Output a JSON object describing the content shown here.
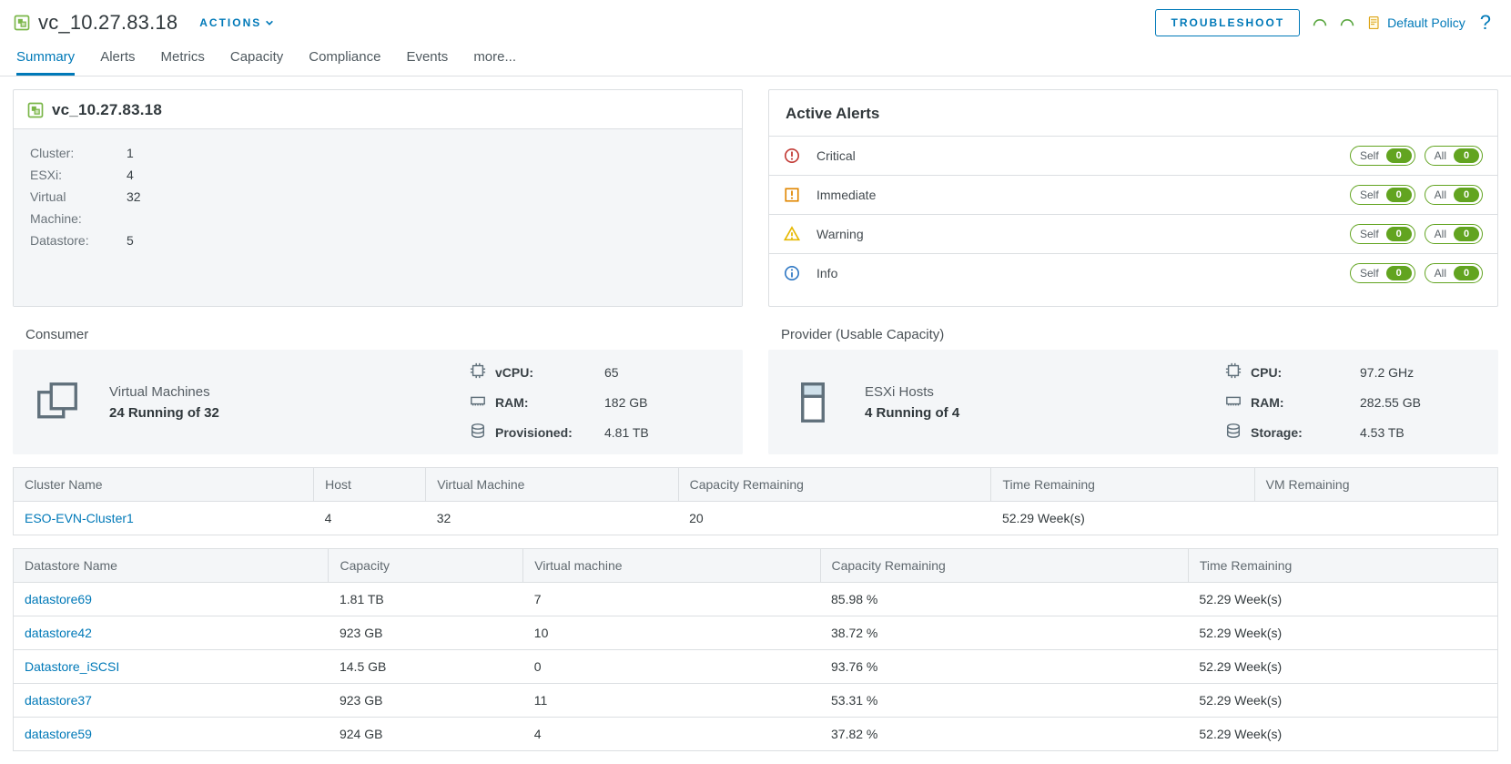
{
  "header": {
    "title": "vc_10.27.83.18",
    "actions_label": "ACTIONS",
    "troubleshoot_label": "TROUBLESHOOT",
    "policy_label": "Default Policy"
  },
  "tabs": [
    "Summary",
    "Alerts",
    "Metrics",
    "Capacity",
    "Compliance",
    "Events",
    "more..."
  ],
  "active_tab": 0,
  "summary_card": {
    "title": "vc_10.27.83.18",
    "rows": [
      {
        "k": "Cluster:",
        "v": "1"
      },
      {
        "k": "ESXi:",
        "v": "4"
      },
      {
        "k": "Virtual Machine:",
        "v": "32"
      },
      {
        "k": "Datastore:",
        "v": "5"
      }
    ]
  },
  "active_alerts": {
    "title": "Active Alerts",
    "rows": [
      {
        "label": "Critical",
        "icon": "critical",
        "self": 0,
        "all": 0
      },
      {
        "label": "Immediate",
        "icon": "immediate",
        "self": 0,
        "all": 0
      },
      {
        "label": "Warning",
        "icon": "warning",
        "self": 0,
        "all": 0
      },
      {
        "label": "Info",
        "icon": "info",
        "self": 0,
        "all": 0
      }
    ],
    "chip_self": "Self",
    "chip_all": "All"
  },
  "consumer": {
    "section_title": "Consumer",
    "head_t1": "Virtual Machines",
    "head_t2": "24 Running of 32",
    "metrics": [
      {
        "icon": "cpu",
        "label": "vCPU:",
        "value": "65"
      },
      {
        "icon": "ram",
        "label": "RAM:",
        "value": "182 GB"
      },
      {
        "icon": "disk",
        "label": "Provisioned:",
        "value": "4.81 TB"
      }
    ]
  },
  "provider": {
    "section_title": "Provider (Usable Capacity)",
    "head_t1": "ESXi Hosts",
    "head_t2": "4 Running of 4",
    "metrics": [
      {
        "icon": "cpu",
        "label": "CPU:",
        "value": "97.2 GHz"
      },
      {
        "icon": "ram",
        "label": "RAM:",
        "value": "282.55 GB"
      },
      {
        "icon": "disk",
        "label": "Storage:",
        "value": "4.53 TB"
      }
    ]
  },
  "cluster_table": {
    "columns": [
      "Cluster Name",
      "Host",
      "Virtual Machine",
      "Capacity Remaining",
      "Time Remaining",
      "VM Remaining"
    ],
    "rows": [
      {
        "name": "ESO-EVN-Cluster1",
        "host": "4",
        "vm": "32",
        "cap": "20",
        "time": "52.29 Week(s)",
        "vmr": ""
      }
    ]
  },
  "datastore_table": {
    "columns": [
      "Datastore Name",
      "Capacity",
      "Virtual machine",
      "Capacity Remaining",
      "Time Remaining"
    ],
    "rows": [
      {
        "name": "datastore69",
        "cap": "1.81 TB",
        "vm": "7",
        "capr": "85.98 %",
        "time": "52.29 Week(s)"
      },
      {
        "name": "datastore42",
        "cap": "923 GB",
        "vm": "10",
        "capr": "38.72 %",
        "time": "52.29 Week(s)"
      },
      {
        "name": "Datastore_iSCSI",
        "cap": "14.5 GB",
        "vm": "0",
        "capr": "93.76 %",
        "time": "52.29 Week(s)"
      },
      {
        "name": "datastore37",
        "cap": "923 GB",
        "vm": "11",
        "capr": "53.31 %",
        "time": "52.29 Week(s)"
      },
      {
        "name": "datastore59",
        "cap": "924 GB",
        "vm": "4",
        "capr": "37.82 %",
        "time": "52.29 Week(s)"
      }
    ]
  }
}
